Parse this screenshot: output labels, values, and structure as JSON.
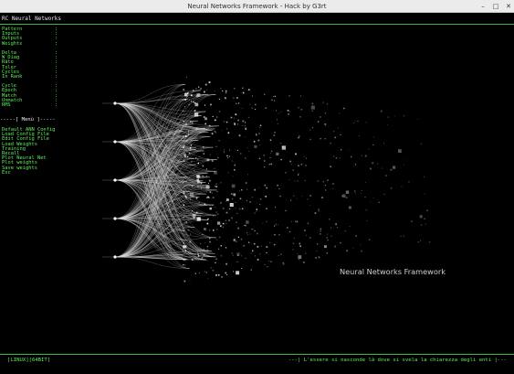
{
  "window": {
    "title": "Neural Networks Framework - Hack by G3rt",
    "minimize_glyph": "–",
    "maximize_glyph": "□",
    "close_glyph": "✕"
  },
  "app": {
    "header": "RC Neural Networks"
  },
  "params": [
    {
      "label": "Pattern",
      "value": ":"
    },
    {
      "label": "Inputs",
      "value": ":"
    },
    {
      "label": "Outputs",
      "value": ":"
    },
    {
      "label": "Weights",
      "value": ":"
    },
    {
      "label": "",
      "value": ""
    },
    {
      "label": "Delta",
      "value": ":"
    },
    {
      "label": "W_Diag",
      "value": ":"
    },
    {
      "label": "Rate",
      "value": ":"
    },
    {
      "label": "Toler",
      "value": ":"
    },
    {
      "label": "Cycles",
      "value": ":"
    },
    {
      "label": "In Rank",
      "value": ":"
    },
    {
      "label": "",
      "value": ""
    },
    {
      "label": "Cycle",
      "value": ":"
    },
    {
      "label": "Epoch",
      "value": ":"
    },
    {
      "label": "Match",
      "value": ":"
    },
    {
      "label": "Unmatch",
      "value": ":"
    },
    {
      "label": "RMS",
      "value": ":"
    }
  ],
  "menu": {
    "title": "-----[ Menù ]-----",
    "items": [
      "Default ANN Config",
      "Load Config File",
      "Edit Config File",
      "Load Weights",
      "Training",
      "Recall",
      "Plot Neural Net",
      "Plot weights",
      "Save weights",
      "Esc"
    ]
  },
  "visualization": {
    "title": "Neural Networks Framework",
    "line_color": "#d8d8d8",
    "node_color": "#ffffff"
  },
  "status": {
    "left": "[LINUX][64BIT]",
    "right": "---| L'essere si nasconde là dove si svela la chiarezza degli enti |---"
  },
  "colors": {
    "terminal_green": "#5cf05c",
    "background": "#000000",
    "rule": "#3fb83f"
  }
}
